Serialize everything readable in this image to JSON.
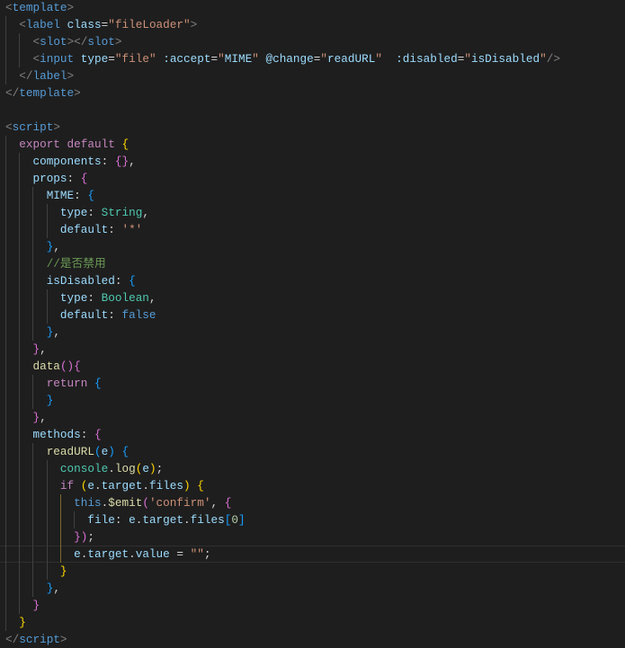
{
  "editor": {
    "theme_background": "#1e1e1e",
    "active_line": 33,
    "lines": [
      {
        "indent": 0,
        "tokens": [
          [
            "<",
            "p"
          ],
          [
            "template",
            "t"
          ],
          [
            ">",
            "p"
          ]
        ]
      },
      {
        "indent": 1,
        "tokens": [
          [
            "<",
            "p"
          ],
          [
            "label",
            "t"
          ],
          [
            " ",
            "d"
          ],
          [
            "class",
            "a"
          ],
          [
            "=",
            "d"
          ],
          [
            "\"fileLoader\"",
            "s"
          ],
          [
            ">",
            "p"
          ]
        ]
      },
      {
        "indent": 2,
        "tokens": [
          [
            "<",
            "p"
          ],
          [
            "slot",
            "t"
          ],
          [
            "></",
            "p"
          ],
          [
            "slot",
            "t"
          ],
          [
            ">",
            "p"
          ]
        ]
      },
      {
        "indent": 2,
        "tokens": [
          [
            "<",
            "p"
          ],
          [
            "input",
            "t"
          ],
          [
            " ",
            "d"
          ],
          [
            "type",
            "a"
          ],
          [
            "=",
            "d"
          ],
          [
            "\"file\"",
            "s"
          ],
          [
            " ",
            "d"
          ],
          [
            ":accept",
            "a"
          ],
          [
            "=",
            "d"
          ],
          [
            "\"",
            "s"
          ],
          [
            "MIME",
            "v"
          ],
          [
            "\"",
            "s"
          ],
          [
            " ",
            "d"
          ],
          [
            "@change",
            "a"
          ],
          [
            "=",
            "d"
          ],
          [
            "\"",
            "s"
          ],
          [
            "readURL",
            "v"
          ],
          [
            "\"",
            "s"
          ],
          [
            "  ",
            "d"
          ],
          [
            ":disabled",
            "a"
          ],
          [
            "=",
            "d"
          ],
          [
            "\"",
            "s"
          ],
          [
            "isDisabled",
            "v"
          ],
          [
            "\"",
            "s"
          ],
          [
            "/>",
            "p"
          ]
        ]
      },
      {
        "indent": 1,
        "tokens": [
          [
            "</",
            "p"
          ],
          [
            "label",
            "t"
          ],
          [
            ">",
            "p"
          ]
        ]
      },
      {
        "indent": 0,
        "tokens": [
          [
            "</",
            "p"
          ],
          [
            "template",
            "t"
          ],
          [
            ">",
            "p"
          ]
        ]
      },
      {
        "indent": 0,
        "tokens": []
      },
      {
        "indent": 0,
        "tokens": [
          [
            "<",
            "p"
          ],
          [
            "script",
            "t"
          ],
          [
            ">",
            "p"
          ]
        ]
      },
      {
        "indent": 1,
        "tokens": [
          [
            "export",
            "k"
          ],
          [
            " ",
            "d"
          ],
          [
            "default",
            "k"
          ],
          [
            " ",
            "d"
          ],
          [
            "{",
            "b1"
          ]
        ]
      },
      {
        "indent": 2,
        "tokens": [
          [
            "components",
            "v"
          ],
          [
            ": ",
            "d"
          ],
          [
            "{}",
            "b2"
          ],
          [
            ",",
            "d"
          ]
        ]
      },
      {
        "indent": 2,
        "tokens": [
          [
            "props",
            "v"
          ],
          [
            ": ",
            "d"
          ],
          [
            "{",
            "b2"
          ]
        ]
      },
      {
        "indent": 3,
        "tokens": [
          [
            "MIME",
            "v"
          ],
          [
            ": ",
            "d"
          ],
          [
            "{",
            "b3"
          ]
        ]
      },
      {
        "indent": 4,
        "tokens": [
          [
            "type",
            "v"
          ],
          [
            ": ",
            "d"
          ],
          [
            "String",
            "c"
          ],
          [
            ",",
            "d"
          ]
        ]
      },
      {
        "indent": 4,
        "tokens": [
          [
            "default",
            "v"
          ],
          [
            ": ",
            "d"
          ],
          [
            "'*'",
            "s"
          ]
        ]
      },
      {
        "indent": 3,
        "tokens": [
          [
            "}",
            "b3"
          ],
          [
            ",",
            "d"
          ]
        ]
      },
      {
        "indent": 3,
        "tokens": [
          [
            "//是否禁用",
            "m"
          ]
        ]
      },
      {
        "indent": 3,
        "tokens": [
          [
            "isDisabled",
            "v"
          ],
          [
            ": ",
            "d"
          ],
          [
            "{",
            "b3"
          ]
        ]
      },
      {
        "indent": 4,
        "tokens": [
          [
            "type",
            "v"
          ],
          [
            ": ",
            "d"
          ],
          [
            "Boolean",
            "c"
          ],
          [
            ",",
            "d"
          ]
        ]
      },
      {
        "indent": 4,
        "tokens": [
          [
            "default",
            "v"
          ],
          [
            ": ",
            "d"
          ],
          [
            "false",
            "bl"
          ]
        ]
      },
      {
        "indent": 3,
        "tokens": [
          [
            "}",
            "b3"
          ],
          [
            ",",
            "d"
          ]
        ]
      },
      {
        "indent": 2,
        "tokens": [
          [
            "}",
            "b2"
          ],
          [
            ",",
            "d"
          ]
        ]
      },
      {
        "indent": 2,
        "tokens": [
          [
            "data",
            "f"
          ],
          [
            "(){",
            "b2"
          ]
        ]
      },
      {
        "indent": 3,
        "tokens": [
          [
            "return",
            "k"
          ],
          [
            " ",
            "d"
          ],
          [
            "{",
            "b3"
          ]
        ]
      },
      {
        "indent": 3,
        "tokens": [
          [
            "}",
            "b3"
          ]
        ]
      },
      {
        "indent": 2,
        "tokens": [
          [
            "}",
            "b2"
          ],
          [
            ",",
            "d"
          ]
        ]
      },
      {
        "indent": 2,
        "tokens": [
          [
            "methods",
            "v"
          ],
          [
            ": ",
            "d"
          ],
          [
            "{",
            "b2"
          ]
        ]
      },
      {
        "indent": 3,
        "tokens": [
          [
            "readURL",
            "f"
          ],
          [
            "(",
            "b3"
          ],
          [
            "e",
            "v"
          ],
          [
            ")",
            "b3"
          ],
          [
            " ",
            "d"
          ],
          [
            "{",
            "b3"
          ]
        ]
      },
      {
        "indent": 4,
        "tokens": [
          [
            "console",
            "c"
          ],
          [
            ".",
            "d"
          ],
          [
            "log",
            "f"
          ],
          [
            "(",
            "b1"
          ],
          [
            "e",
            "v"
          ],
          [
            ")",
            "b1"
          ],
          [
            ";",
            "d"
          ]
        ]
      },
      {
        "indent": 4,
        "tokens": [
          [
            "if",
            "k"
          ],
          [
            " ",
            "d"
          ],
          [
            "(",
            "b1"
          ],
          [
            "e",
            "v"
          ],
          [
            ".",
            "d"
          ],
          [
            "target",
            "v"
          ],
          [
            ".",
            "d"
          ],
          [
            "files",
            "v"
          ],
          [
            ")",
            "b1"
          ],
          [
            " ",
            "d"
          ],
          [
            "{",
            "b1"
          ]
        ]
      },
      {
        "indent": 5,
        "tokens": [
          [
            "this",
            "bl"
          ],
          [
            ".",
            "d"
          ],
          [
            "$emit",
            "f"
          ],
          [
            "(",
            "b2"
          ],
          [
            "'confirm'",
            "s"
          ],
          [
            ", ",
            "d"
          ],
          [
            "{",
            "b2"
          ]
        ]
      },
      {
        "indent": 6,
        "tokens": [
          [
            "file",
            "v"
          ],
          [
            ": ",
            "d"
          ],
          [
            "e",
            "v"
          ],
          [
            ".",
            "d"
          ],
          [
            "target",
            "v"
          ],
          [
            ".",
            "d"
          ],
          [
            "files",
            "v"
          ],
          [
            "[",
            "b3"
          ],
          [
            "0",
            "n"
          ],
          [
            "]",
            "b3"
          ]
        ]
      },
      {
        "indent": 5,
        "tokens": [
          [
            "}",
            "b2"
          ],
          [
            ")",
            "b2"
          ],
          [
            ";",
            "d"
          ]
        ]
      },
      {
        "indent": 5,
        "tokens": [
          [
            "e",
            "v"
          ],
          [
            ".",
            "d"
          ],
          [
            "target",
            "v"
          ],
          [
            ".",
            "d"
          ],
          [
            "value",
            "v"
          ],
          [
            " = ",
            "d"
          ],
          [
            "\"\"",
            "s"
          ],
          [
            ";",
            "d"
          ]
        ]
      },
      {
        "indent": 4,
        "tokens": [
          [
            "}",
            "b1"
          ]
        ]
      },
      {
        "indent": 3,
        "tokens": [
          [
            "}",
            "b3"
          ],
          [
            ",",
            "d"
          ]
        ]
      },
      {
        "indent": 2,
        "tokens": [
          [
            "}",
            "b2"
          ]
        ]
      },
      {
        "indent": 1,
        "tokens": [
          [
            "}",
            "b1"
          ]
        ]
      },
      {
        "indent": 0,
        "tokens": [
          [
            "</",
            "p"
          ],
          [
            "script",
            "t"
          ],
          [
            ">",
            "p"
          ]
        ]
      }
    ]
  }
}
